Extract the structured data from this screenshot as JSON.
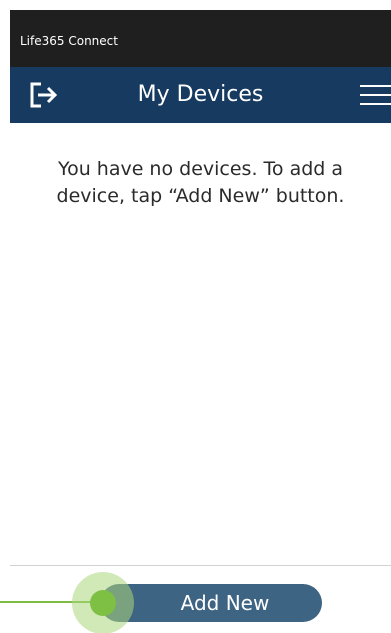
{
  "status_bar": {
    "app_name": "Life365 Connect"
  },
  "nav_bar": {
    "title": "My Devices",
    "logout_icon": "logout-arrow-icon",
    "menu_icon": "hamburger-menu-icon"
  },
  "main": {
    "empty_message": "You have no devices. To add a device, tap “Add New” button."
  },
  "footer": {
    "add_button_label": "Add New"
  },
  "colors": {
    "status_bar_bg": "#1f1f1f",
    "nav_bar_bg": "#163a60",
    "button_bg": "#3e6483",
    "highlight_green": "#7dc043"
  }
}
